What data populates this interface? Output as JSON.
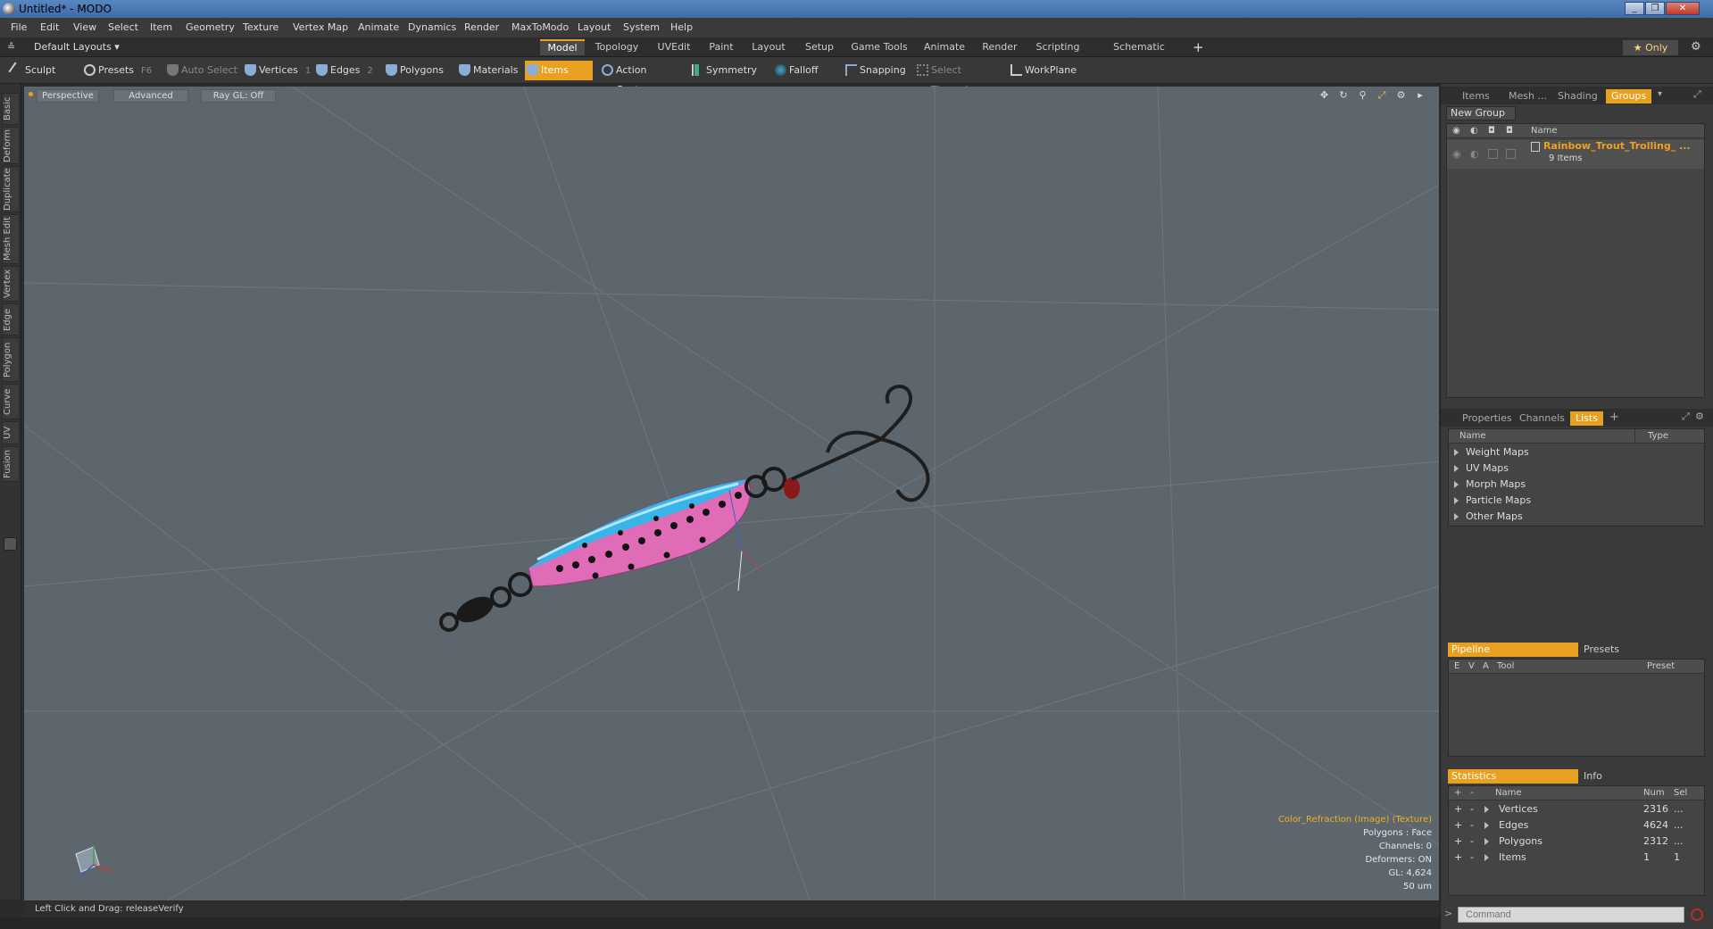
{
  "window": {
    "title": "Untitled* - MODO",
    "minimize": "_",
    "maximize": "❐",
    "close": "✕"
  },
  "menubar": [
    "File",
    "Edit",
    "View",
    "Select",
    "Item",
    "Geometry",
    "Texture",
    "Vertex Map",
    "Animate",
    "Dynamics",
    "Render",
    "MaxToModo",
    "Layout",
    "System",
    "Help"
  ],
  "layout_selector": "Default Layouts ▾",
  "layout_tabs": [
    "Model",
    "Topology",
    "UVEdit",
    "Paint",
    "Layout",
    "Setup",
    "Game Tools",
    "Animate",
    "Render",
    "Scripting",
    "Schematic Fusion"
  ],
  "active_layout_tab": "Model",
  "add_tab_label": "+",
  "only_label": "★ Only",
  "toolbar": {
    "sculpt": "Sculpt",
    "presets": "Presets",
    "presets_key": "F6",
    "auto_select": "Auto Select",
    "vertices": "Vertices",
    "vertices_key": "1",
    "edges": "Edges",
    "edges_key": "2",
    "polygons": "Polygons",
    "materials": "Materials",
    "items": "Items",
    "action_center": "Action Center",
    "symmetry": "Symmetry",
    "falloff": "Falloff",
    "snapping": "Snapping",
    "select_through": "Select Through",
    "workplane": "WorkPlane"
  },
  "left_tabs": [
    "Basic",
    "Deform",
    "Duplicate",
    "Mesh Edit",
    "Vertex",
    "Edge",
    "Polygon",
    "Curve",
    "UV",
    "Fusion"
  ],
  "viewport": {
    "view_mode": "Perspective",
    "shading": "Advanced",
    "raygl": "Ray GL: Off",
    "info": {
      "texture": "Color_Refraction (Image) (Texture)",
      "polygons": "Polygons : Face",
      "channels": "Channels: 0",
      "deformers": "Deformers: ON",
      "gl": "GL: 4,624",
      "scale": "50 um"
    }
  },
  "status_line": "Left Click and Drag:   releaseVerify",
  "right_panel": {
    "top_tabs": [
      "Items",
      "Mesh ...",
      "Shading",
      "Groups"
    ],
    "active_top_tab": "Groups",
    "new_group": "New Group",
    "groups_header": "Name",
    "group_item": {
      "name": "Rainbow_Trout_Trolling_ ...",
      "count": "9 Items"
    },
    "mid_tabs": [
      "Properties",
      "Channels",
      "Lists"
    ],
    "active_mid_tab": "Lists",
    "lists_headers": {
      "name": "Name",
      "type": "Type"
    },
    "lists_items": [
      "Weight Maps",
      "UV Maps",
      "Morph Maps",
      "Particle Maps",
      "Other Maps"
    ],
    "pipeline_tab": "Pipeline",
    "presets_tab": "Presets",
    "pipeline_headers": {
      "e": "E",
      "v": "V",
      "a": "A",
      "tool": "Tool",
      "preset": "Preset"
    },
    "stats_tab": "Statistics",
    "info_tab": "Info",
    "stats_headers": {
      "plus": "+",
      "minus": "-",
      "name": "Name",
      "num": "Num",
      "sel": "Sel"
    },
    "stats_rows": [
      {
        "name": "Vertices",
        "num": "2316",
        "sel": "..."
      },
      {
        "name": "Edges",
        "num": "4624",
        "sel": "..."
      },
      {
        "name": "Polygons",
        "num": "2312",
        "sel": "..."
      },
      {
        "name": "Items",
        "num": "1",
        "sel": "1"
      }
    ]
  },
  "command_placeholder": "Command",
  "command_prompt": ">",
  "colors": {
    "accent": "#e8a020",
    "viewport_bg": "#5c666c",
    "lure_body": "#e070b8",
    "lure_top": "#40b8e8"
  }
}
